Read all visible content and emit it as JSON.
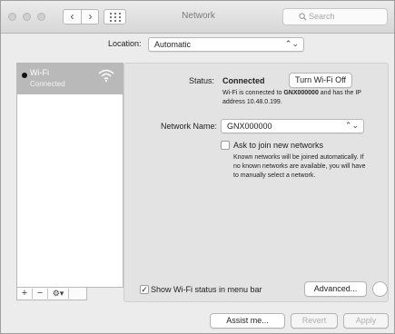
{
  "window": {
    "title": "Network",
    "search_placeholder": "Search",
    "nav_back_glyph": "‹",
    "nav_forward_glyph": "›"
  },
  "location": {
    "label": "Location:",
    "value": "Automatic",
    "arrow": "⌃⌄"
  },
  "sidebar": {
    "items": [
      {
        "name": "Wi-Fi",
        "status": "Connected",
        "icon": "wifi-icon"
      }
    ],
    "tools": {
      "add": "+",
      "remove": "−",
      "gear": "⚙▾"
    }
  },
  "panel": {
    "status_label": "Status:",
    "status_value": "Connected",
    "turn_off_button": "Turn Wi-Fi Off",
    "status_description_1": "Wi-Fi is connected to ",
    "status_description_network": "GNX000000",
    "status_description_2": " and has the IP address 10.48.0.199.",
    "network_name_label": "Network Name:",
    "network_name_value": "GNX000000",
    "ask_to_join_label": "Ask to join new networks",
    "ask_to_join_checked": false,
    "ask_to_join_note": "Known networks will be joined automatically. If no known networks are available, you will have to manually select a network.",
    "show_status_label": "Show Wi-Fi status in menu bar",
    "show_status_checked": true,
    "show_status_check_glyph": "✓",
    "advanced_button": "Advanced..."
  },
  "footer": {
    "assist_button": "Assist me...",
    "revert_button": "Revert",
    "apply_button": "Apply"
  },
  "colors": {
    "selection": "#b9b9b9",
    "panel_bg": "#e3e3e3",
    "window_bg": "#ececec"
  }
}
